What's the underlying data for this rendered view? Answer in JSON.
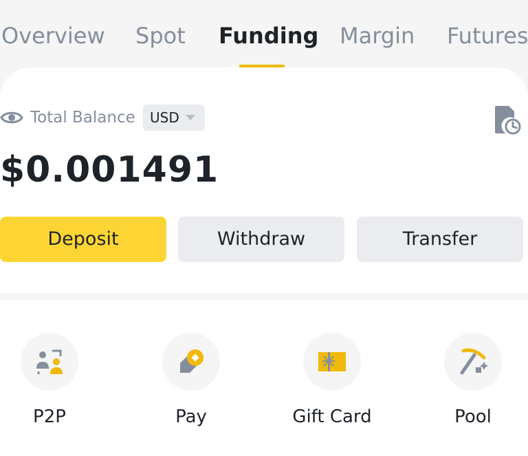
{
  "tabs": [
    {
      "label": "Overview"
    },
    {
      "label": "Spot"
    },
    {
      "label": "Funding"
    },
    {
      "label": "Margin"
    },
    {
      "label": "Futures"
    }
  ],
  "active_tab": "Funding",
  "balance": {
    "label": "Total Balance",
    "currency": "USD",
    "value": "$0.001491"
  },
  "actions": {
    "deposit": "Deposit",
    "withdraw": "Withdraw",
    "transfer": "Transfer"
  },
  "shortcuts": [
    {
      "label": "P2P",
      "icon": "p2p-icon"
    },
    {
      "label": "Pay",
      "icon": "pay-icon"
    },
    {
      "label": "Gift Card",
      "icon": "gift-card-icon"
    },
    {
      "label": "Pool",
      "icon": "pool-icon"
    }
  ],
  "colors": {
    "accent": "#f0b90b",
    "primary_button": "#fcd535",
    "secondary_button": "#eaecef",
    "text_primary": "#1e2329",
    "text_secondary": "#848e9c"
  }
}
